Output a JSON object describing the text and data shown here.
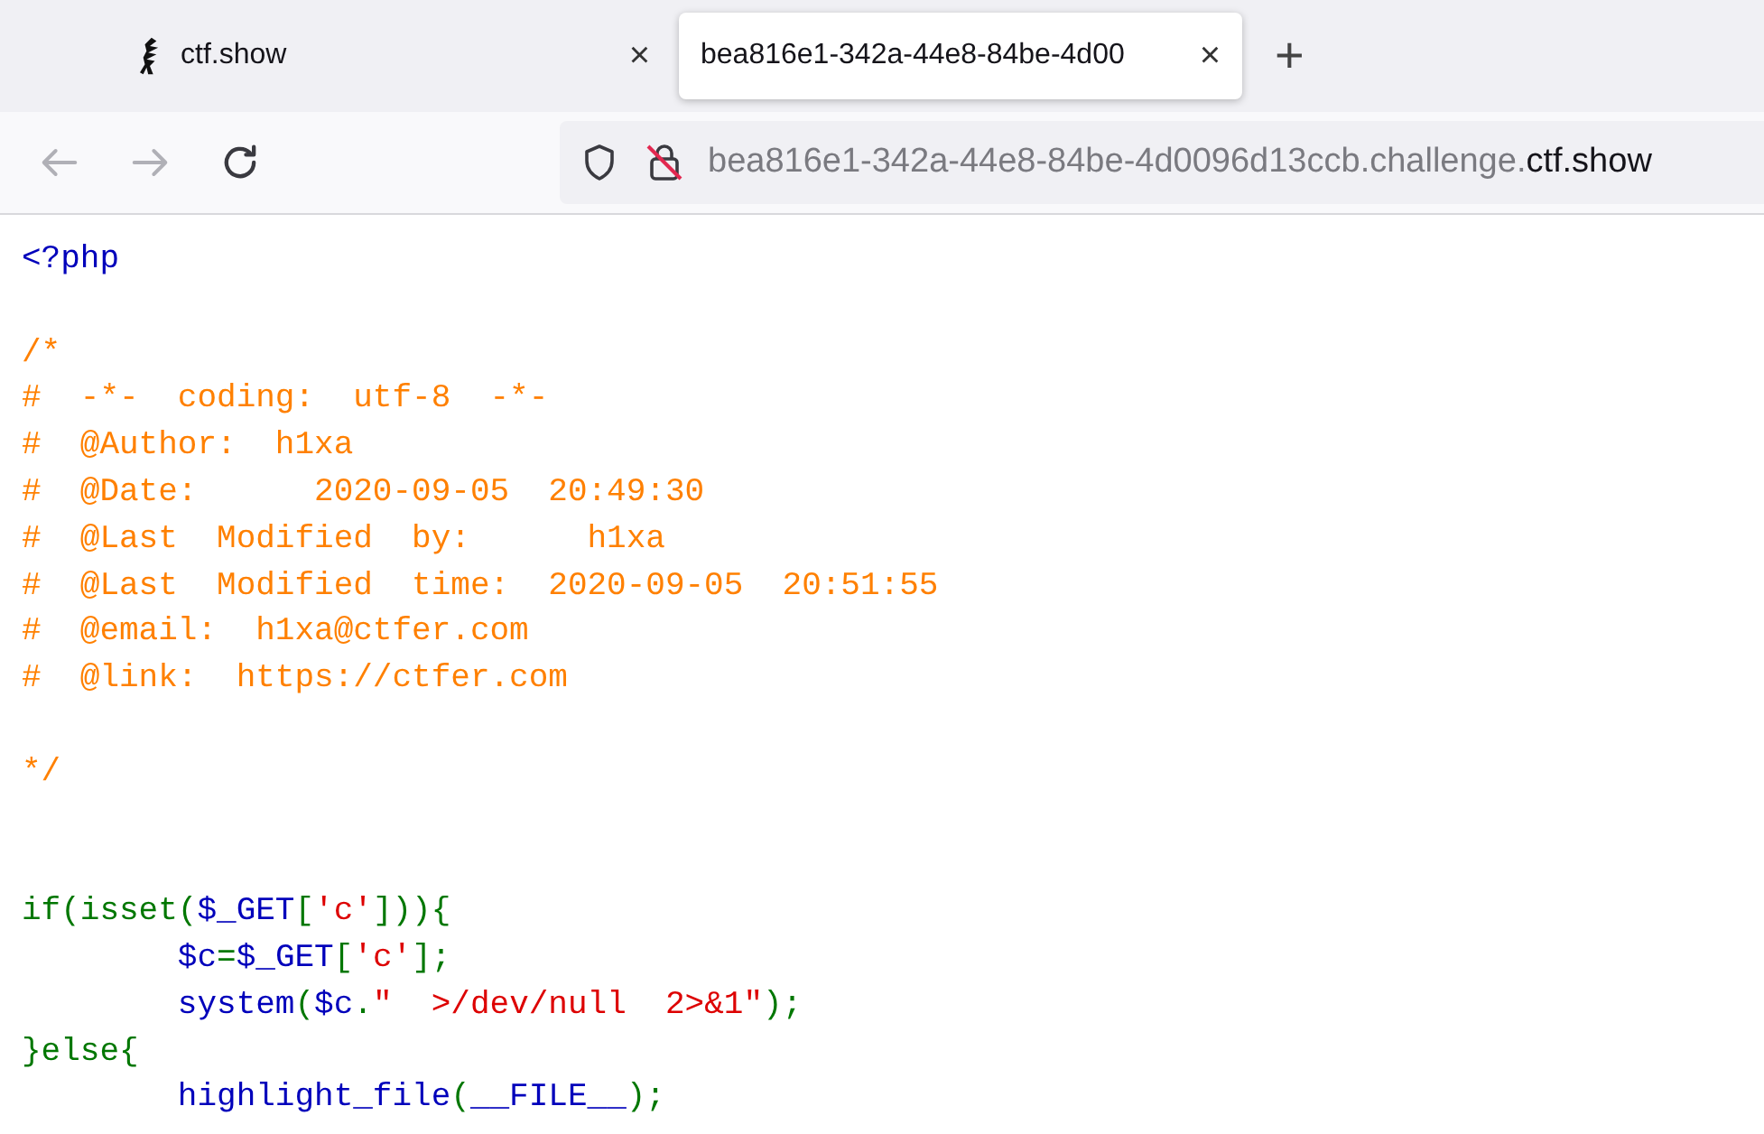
{
  "tabs": [
    {
      "title": "ctf.show",
      "selected": false,
      "close": "×"
    },
    {
      "title": "bea816e1-342a-44e8-84be-4d00",
      "selected": true,
      "close": "×"
    }
  ],
  "new_tab": "+",
  "nav": {
    "back_disabled": true,
    "forward_disabled": true
  },
  "address_bar": {
    "url_prefix": "bea816e1-342a-44e8-84be-4d0096d13ccb.challenge.",
    "url_domain": "ctf.show"
  },
  "code_blocks": [
    {
      "wide_gap_after": false,
      "lines": [
        [
          {
            "kind": "default",
            "text": "<?php"
          }
        ]
      ]
    },
    {
      "wide_gap_after": false,
      "lines": [
        [
          {
            "kind": "comment",
            "text": "/*"
          }
        ],
        [
          {
            "kind": "comment",
            "text": "#  -*-  coding:  utf-8  -*-"
          }
        ],
        [
          {
            "kind": "comment",
            "text": "#  @Author:  h1xa"
          }
        ],
        [
          {
            "kind": "comment",
            "text": "#  @Date:      2020-09-05  20:49:30"
          }
        ],
        [
          {
            "kind": "comment",
            "text": "#  @Last  Modified  by:      h1xa"
          }
        ],
        [
          {
            "kind": "comment",
            "text": "#  @Last  Modified  time:  2020-09-05  20:51:55"
          }
        ],
        [
          {
            "kind": "comment",
            "text": "#  @email:  h1xa@ctfer.com"
          }
        ],
        [
          {
            "kind": "comment",
            "text": "#  @link:  https://ctfer.com"
          }
        ]
      ]
    },
    {
      "wide_gap_after": true,
      "lines": [
        [
          {
            "kind": "comment",
            "text": "*/"
          }
        ]
      ]
    },
    {
      "lines": [
        [
          {
            "kind": "keyword",
            "text": "if(isset("
          },
          {
            "kind": "default",
            "text": "$_GET"
          },
          {
            "kind": "keyword",
            "text": "["
          },
          {
            "kind": "string",
            "text": "'c'"
          },
          {
            "kind": "keyword",
            "text": "])){"
          }
        ],
        [
          {
            "kind": "default",
            "text": "        $c"
          },
          {
            "kind": "keyword",
            "text": "="
          },
          {
            "kind": "default",
            "text": "$_GET"
          },
          {
            "kind": "keyword",
            "text": "["
          },
          {
            "kind": "string",
            "text": "'c'"
          },
          {
            "kind": "keyword",
            "text": "];"
          }
        ],
        [
          {
            "kind": "default",
            "text": "        system"
          },
          {
            "kind": "keyword",
            "text": "("
          },
          {
            "kind": "default",
            "text": "$c"
          },
          {
            "kind": "keyword",
            "text": "."
          },
          {
            "kind": "string",
            "text": "\"  >/dev/null  2>&1\""
          },
          {
            "kind": "keyword",
            "text": ");"
          }
        ],
        [
          {
            "kind": "keyword",
            "text": "}else{"
          }
        ],
        [
          {
            "kind": "default",
            "text": "        highlight_file"
          },
          {
            "kind": "keyword",
            "text": "("
          },
          {
            "kind": "default",
            "text": "__FILE__"
          },
          {
            "kind": "keyword",
            "text": ");"
          }
        ]
      ]
    }
  ]
}
